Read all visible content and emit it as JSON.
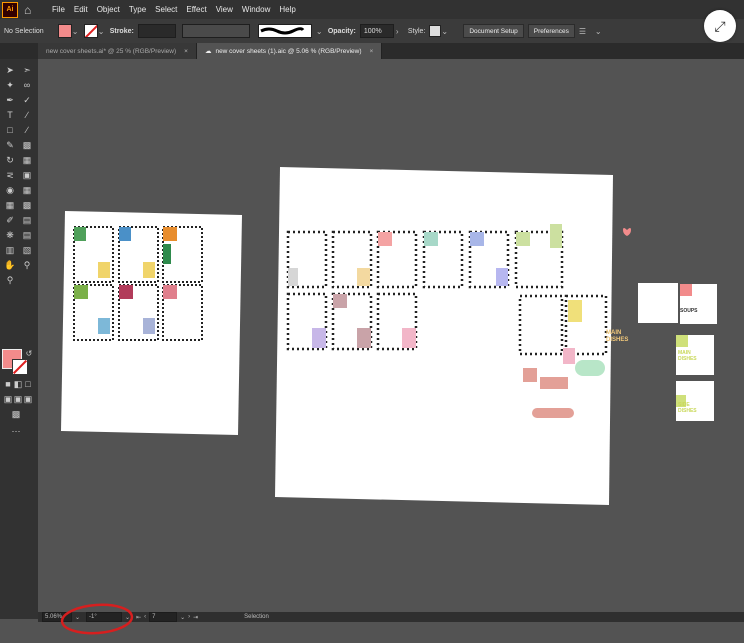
{
  "app": {
    "logo_text": "Ai"
  },
  "menu": [
    "File",
    "Edit",
    "Object",
    "Type",
    "Select",
    "Effect",
    "View",
    "Window",
    "Help"
  ],
  "control_bar": {
    "selection_label": "No Selection",
    "stroke_label": "Stroke:",
    "opacity_label": "Opacity:",
    "opacity_value": "100%",
    "style_label": "Style:",
    "document_setup": "Document Setup",
    "preferences": "Preferences",
    "fill_color": "#f28b8b"
  },
  "tabs": [
    {
      "label": "new cover sheets.ai* @ 25 % (RGB/Preview)",
      "active": false
    },
    {
      "label": "new cover sheets (1).aic @ 5.06 % (RGB/Preview)",
      "active": true
    }
  ],
  "status": {
    "zoom": "5.06%",
    "rotate": "-1°",
    "artboard_number": "7",
    "tool_name": "Selection"
  },
  "artwork": {
    "main_dishes_label": "MAIN DISHES",
    "soups_label": "SOUPS",
    "side_dishes_label": "SIDE DISHES"
  }
}
